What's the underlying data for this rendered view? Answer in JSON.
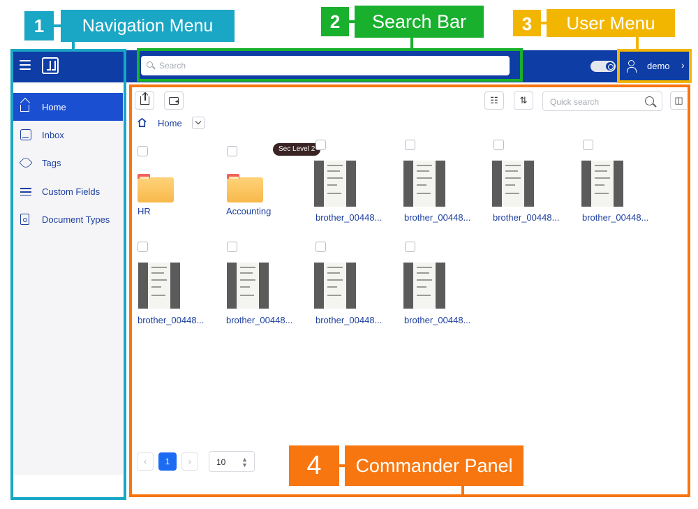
{
  "annotations": {
    "nav": {
      "number": "1",
      "label": "Navigation Menu",
      "color": "#1aa6c5"
    },
    "search": {
      "number": "2",
      "label": "Search Bar",
      "color": "#19b02d"
    },
    "user": {
      "number": "3",
      "label": "User Menu",
      "color": "#f2b600"
    },
    "commander": {
      "number": "4",
      "label": "Commander Panel",
      "color": "#f7760f"
    }
  },
  "header": {
    "search_placeholder": "Search",
    "user_name": "demo",
    "user_chevron": "›",
    "theme_toggle": "dark-mode-toggle",
    "brand_color": "#0e3da6"
  },
  "sidebar": {
    "items": [
      {
        "label": "Home",
        "icon": "home-icon",
        "active": true
      },
      {
        "label": "Inbox",
        "icon": "inbox-icon",
        "active": false
      },
      {
        "label": "Tags",
        "icon": "tag-icon",
        "active": false
      },
      {
        "label": "Custom Fields",
        "icon": "list-icon",
        "active": false
      },
      {
        "label": "Document Types",
        "icon": "document-type-icon",
        "active": false
      }
    ]
  },
  "commander": {
    "quick_search_placeholder": "Quick search",
    "breadcrumb": "Home",
    "badge": "Sec Level 2",
    "folders": [
      {
        "name": "HR"
      },
      {
        "name": "Accounting"
      }
    ],
    "documents": [
      {
        "name": "brother_00448..."
      },
      {
        "name": "brother_00448..."
      },
      {
        "name": "brother_00448..."
      },
      {
        "name": "brother_00448..."
      },
      {
        "name": "brother_00448..."
      },
      {
        "name": "brother_00448..."
      },
      {
        "name": "brother_00448..."
      },
      {
        "name": "brother_00448..."
      }
    ],
    "pagination": {
      "prev": "‹",
      "current": "1",
      "next": "›",
      "page_size": "10",
      "size_arrows": "⌃⌄"
    }
  }
}
